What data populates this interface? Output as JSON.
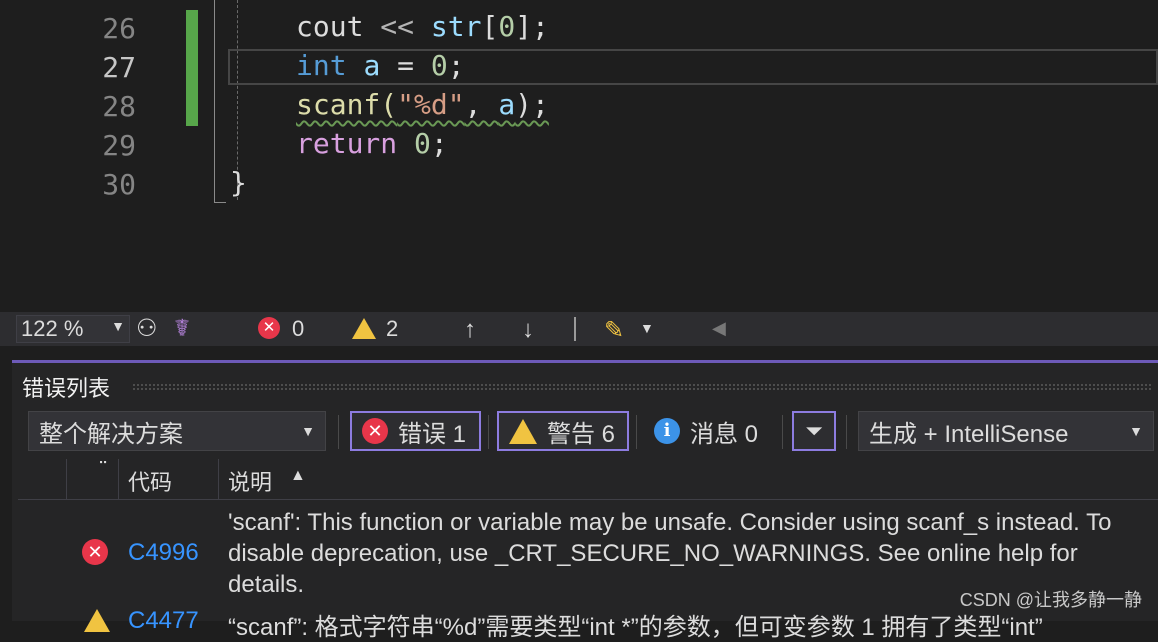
{
  "editor": {
    "lines": [
      {
        "num": "26",
        "tokens": [
          {
            "t": "cout ",
            "c": ""
          },
          {
            "t": "<< ",
            "c": "op"
          },
          {
            "t": "str",
            "c": "var"
          },
          {
            "t": "[",
            "c": ""
          },
          {
            "t": "0",
            "c": "num"
          },
          {
            "t": "];",
            "c": ""
          }
        ]
      },
      {
        "num": "27",
        "tokens": [
          {
            "t": "int ",
            "c": "kw"
          },
          {
            "t": "a",
            "c": "var"
          },
          {
            "t": " = ",
            "c": ""
          },
          {
            "t": "0",
            "c": "num"
          },
          {
            "t": ";",
            "c": ""
          }
        ]
      },
      {
        "num": "28",
        "tokens": [
          {
            "t": "scanf(",
            "c": "fn"
          },
          {
            "t": "\"%d\"",
            "c": "str"
          },
          {
            "t": ", ",
            "c": ""
          },
          {
            "t": "a",
            "c": "var"
          },
          {
            "t": ");",
            "c": ""
          }
        ]
      },
      {
        "num": "29",
        "tokens": [
          {
            "t": "return ",
            "c": "kw2"
          },
          {
            "t": "0",
            "c": "num"
          },
          {
            "t": ";",
            "c": ""
          }
        ]
      },
      {
        "num": "30",
        "tokens": []
      }
    ],
    "closing_brace": "}"
  },
  "status": {
    "zoom": "122 %",
    "errors": "0",
    "warnings": "2"
  },
  "error_list": {
    "title": "错误列表",
    "scope": "整个解决方案",
    "errors_label": "错误 1",
    "warnings_label": "警告 6",
    "messages_label": "消息 0",
    "source": "生成 + IntelliSense",
    "col_code": "代码",
    "col_desc": "说明",
    "rows": [
      {
        "code": "C4996",
        "desc": "'scanf': This function or variable may be unsafe. Consider using scanf_s instead. To disable deprecation, use _CRT_SECURE_NO_WARNINGS. See online help for details."
      },
      {
        "code": "C4477",
        "desc": "“scanf”: 格式字符串“%d”需要类型“int *”的参数，但可变参数 1 拥有了类型“int”"
      }
    ]
  },
  "watermark": "CSDN @让我多静一静",
  "colors": {
    "accent": "#8d7ce0",
    "error": "#e8364a",
    "warning": "#f0c341",
    "info": "#3c93e8",
    "changebar": "#57a64a"
  }
}
